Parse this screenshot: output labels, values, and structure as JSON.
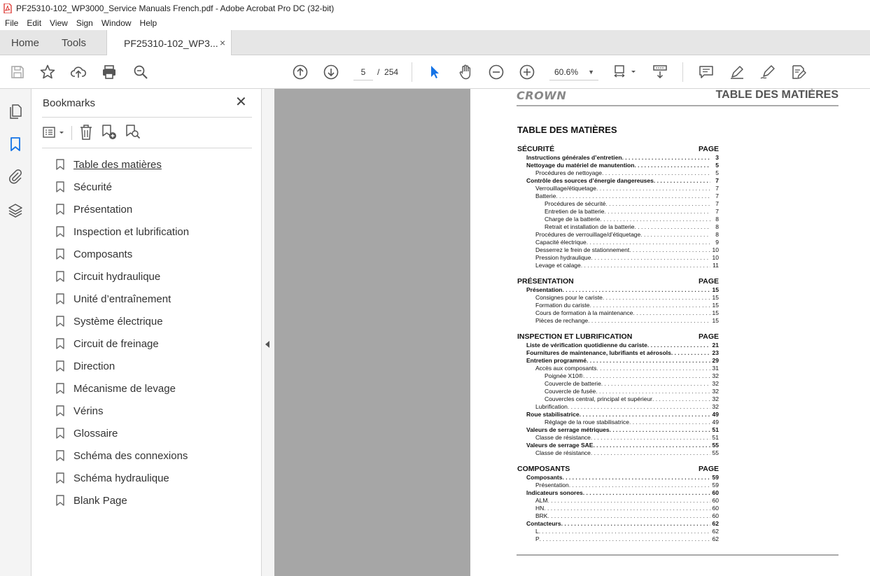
{
  "window": {
    "title": "PF25310-102_WP3000_Service Manuals French.pdf - Adobe Acrobat Pro DC (32-bit)"
  },
  "menu": [
    "File",
    "Edit",
    "View",
    "Sign",
    "Window",
    "Help"
  ],
  "tabs": {
    "home": "Home",
    "tools": "Tools",
    "doc": "PF25310-102_WP3...",
    "close": "×"
  },
  "toolbar": {
    "page_current": "5",
    "page_sep": "/",
    "page_total": "254",
    "zoom": "60.6%"
  },
  "bookmarks": {
    "title": "Bookmarks",
    "close": "✕",
    "items": [
      "Table des matières",
      "Sécurité",
      "Présentation",
      "Inspection et lubrification",
      "Composants",
      "Circuit hydraulique",
      "Unité d’entraînement",
      "Système électrique",
      "Circuit de freinage",
      "Direction",
      "Mécanisme de levage",
      "Vérins",
      "Glossaire",
      "Schéma des connexions",
      "Schéma hydraulique",
      "Blank Page"
    ]
  },
  "document": {
    "logo": "CROWN",
    "header_title": "TABLE DES MATIÈRES",
    "heading": "TABLE DES MATIÈRES",
    "sections": [
      {
        "title": "SÉCURITÉ",
        "page_label": "PAGE",
        "entries": [
          {
            "level": 1,
            "text": "Instructions générales d’entretien",
            "page": "3"
          },
          {
            "level": 1,
            "text": "Nettoyage du matériel de manutention",
            "page": "5"
          },
          {
            "level": 2,
            "text": "Procédures de nettoyage",
            "page": "5"
          },
          {
            "level": 1,
            "text": "Contrôle des sources d’énergie dangereuses",
            "page": "7"
          },
          {
            "level": 2,
            "text": "Verrouillage/étiquetage",
            "page": "7"
          },
          {
            "level": 2,
            "text": "Batterie",
            "page": "7"
          },
          {
            "level": 3,
            "text": "Procédures de sécurité",
            "page": "7"
          },
          {
            "level": 3,
            "text": "Entretien de la batterie",
            "page": "7"
          },
          {
            "level": 3,
            "text": "Charge de la batterie",
            "page": "8"
          },
          {
            "level": 3,
            "text": "Retrait et installation de la batterie",
            "page": "8"
          },
          {
            "level": 2,
            "text": "Procédures de verrouillage/d’étiquetage",
            "page": "8"
          },
          {
            "level": 2,
            "text": "Capacité électrique",
            "page": "9"
          },
          {
            "level": 2,
            "text": "Desserrez le frein de stationnement",
            "page": "10"
          },
          {
            "level": 2,
            "text": "Pression hydraulique",
            "page": "10"
          },
          {
            "level": 2,
            "text": "Levage et calage",
            "page": "11"
          }
        ]
      },
      {
        "title": "PRÉSENTATION",
        "page_label": "PAGE",
        "entries": [
          {
            "level": 1,
            "text": "Présentation",
            "page": "15"
          },
          {
            "level": 2,
            "text": "Consignes pour le cariste",
            "page": "15"
          },
          {
            "level": 2,
            "text": "Formation du cariste",
            "page": "15"
          },
          {
            "level": 2,
            "text": "Cours de formation à la maintenance",
            "page": "15"
          },
          {
            "level": 2,
            "text": "Pièces de rechange",
            "page": "15"
          }
        ]
      },
      {
        "title": "INSPECTION ET LUBRIFICATION",
        "page_label": "PAGE",
        "entries": [
          {
            "level": 1,
            "text": "Liste de vérification quotidienne du cariste",
            "page": "21"
          },
          {
            "level": 1,
            "text": "Fournitures de maintenance, lubrifiants et aérosols",
            "page": "23"
          },
          {
            "level": 1,
            "text": "Entretien programmé",
            "page": "29"
          },
          {
            "level": 2,
            "text": "Accès aux composants",
            "page": "31"
          },
          {
            "level": 3,
            "text": "Poignée X10®",
            "page": "32"
          },
          {
            "level": 3,
            "text": "Couvercle de batterie",
            "page": "32"
          },
          {
            "level": 3,
            "text": "Couvercle de fusée",
            "page": "32"
          },
          {
            "level": 3,
            "text": "Couvercles central, principal et supérieur",
            "page": "32"
          },
          {
            "level": 2,
            "text": "Lubrification",
            "page": "32"
          },
          {
            "level": 1,
            "text": "Roue stabilisatrice",
            "page": "49"
          },
          {
            "level": 3,
            "text": "Réglage de la roue stabilisatrice",
            "page": "49"
          },
          {
            "level": 1,
            "text": "Valeurs de serrage métriques",
            "page": "51"
          },
          {
            "level": 2,
            "text": "Classe de résistance",
            "page": "51"
          },
          {
            "level": 1,
            "text": "Valeurs de serrage SAE",
            "page": "55"
          },
          {
            "level": 2,
            "text": "Classe de résistance",
            "page": "55"
          }
        ]
      },
      {
        "title": "COMPOSANTS",
        "page_label": "PAGE",
        "entries": [
          {
            "level": 1,
            "text": "Composants",
            "page": "59"
          },
          {
            "level": 2,
            "text": "Présentation",
            "page": "59"
          },
          {
            "level": 1,
            "text": "Indicateurs sonores",
            "page": "60"
          },
          {
            "level": 2,
            "text": "ALM",
            "page": "60"
          },
          {
            "level": 2,
            "text": "HN",
            "page": "60"
          },
          {
            "level": 2,
            "text": "BRK",
            "page": "60"
          },
          {
            "level": 1,
            "text": "Contacteurs",
            "page": "62"
          },
          {
            "level": 2,
            "text": "L",
            "page": "62"
          },
          {
            "level": 2,
            "text": "P",
            "page": "62"
          }
        ]
      }
    ]
  },
  "colors": {
    "pdf_red": "#d9221c",
    "select_blue": "#1473e6",
    "doc_bg": "#a6a6a6",
    "panel_bg": "#f4f4f4"
  }
}
